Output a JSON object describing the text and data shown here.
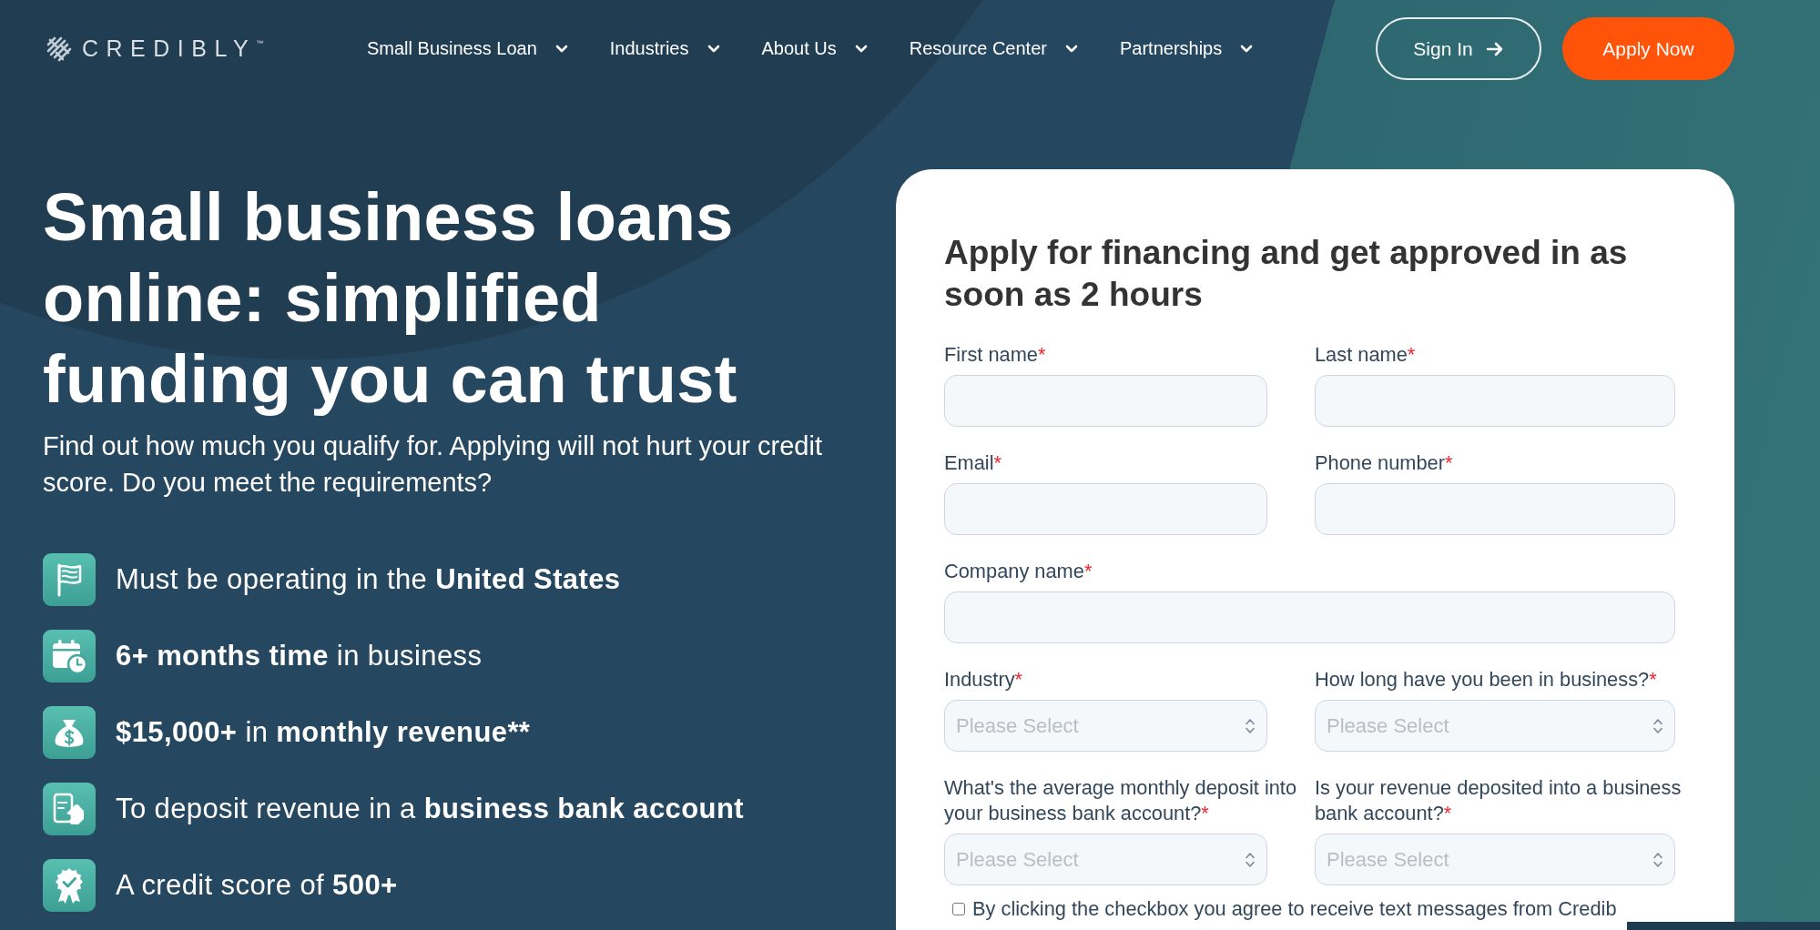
{
  "header": {
    "logo": {
      "text": "CREDIBLY",
      "mark": "™"
    },
    "nav": [
      {
        "label": "Small Business Loan"
      },
      {
        "label": "Industries"
      },
      {
        "label": "About Us"
      },
      {
        "label": "Resource Center"
      },
      {
        "label": "Partnerships"
      }
    ],
    "sign_in": "Sign In",
    "apply": "Apply Now"
  },
  "hero": {
    "title": "Small business loans online: simplified funding you can trust",
    "subtitle": "Find out how much you qualify for. Applying will not hurt your credit score. Do you meet the requirements?",
    "requirements": [
      {
        "parts": [
          {
            "text": "Must be operating in the ",
            "bold": false
          },
          {
            "text": "United States",
            "bold": true
          }
        ]
      },
      {
        "parts": [
          {
            "text": "6+ months time",
            "bold": true
          },
          {
            "text": " in business",
            "bold": false
          }
        ]
      },
      {
        "parts": [
          {
            "text": "$15,000+",
            "bold": true
          },
          {
            "text": " in ",
            "bold": false
          },
          {
            "text": "monthly revenue**",
            "bold": true
          }
        ]
      },
      {
        "parts": [
          {
            "text": "To deposit revenue in a ",
            "bold": false
          },
          {
            "text": "business bank account",
            "bold": true
          }
        ]
      },
      {
        "parts": [
          {
            "text": "A credit score of ",
            "bold": false
          },
          {
            "text": "500+",
            "bold": true
          }
        ]
      }
    ]
  },
  "form": {
    "title": "Apply for financing and get approved in as soon as 2 hours",
    "rows": [
      [
        {
          "kind": "text",
          "label": "First name",
          "required_mark": "*"
        },
        {
          "kind": "text",
          "label": "Last name",
          "required_mark": "*"
        }
      ],
      [
        {
          "kind": "text",
          "label": "Email",
          "required_mark": "*"
        },
        {
          "kind": "text",
          "label": "Phone number",
          "required_mark": "*"
        }
      ],
      [
        {
          "kind": "text",
          "label": "Company name",
          "required_mark": "*"
        }
      ],
      [
        {
          "kind": "select",
          "label": "Industry",
          "required_mark": "*",
          "placeholder": "Please Select"
        },
        {
          "kind": "select",
          "label": "How long have you been in business?",
          "required_mark": "*",
          "placeholder": "Please Select"
        }
      ],
      [
        {
          "kind": "select",
          "label": "What's the average monthly deposit into your business bank account?",
          "required_mark": "*",
          "placeholder": "Please Select"
        },
        {
          "kind": "select",
          "label": "Is your revenue deposited into a business bank account?",
          "required_mark": "*",
          "placeholder": "Please Select"
        }
      ]
    ],
    "consent": {
      "checked": false,
      "label": "By clicking the checkbox you agree to receive text messages from Credib"
    }
  }
}
